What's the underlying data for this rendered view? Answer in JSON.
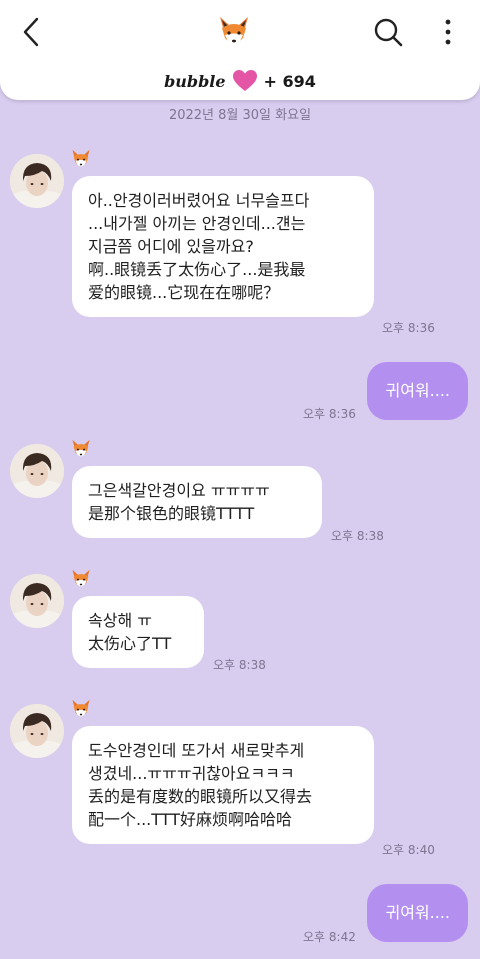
{
  "header": {
    "bubble_label": "bubble",
    "bubble_count": "+ 694"
  },
  "date_divider": "2022년 8월 30일 화요일",
  "messages": [
    {
      "lines": [
        "아..안경이러버렸어요 너무슬프다",
        "...내가젤 아끼는 안경인데...걘는",
        "지금쯤 어디에 있을까요?",
        "啊..眼镜丢了太伤心了...是我最",
        "爱的眼镜...它现在在哪呢？"
      ],
      "time": "오후 8:36"
    },
    {
      "text": "귀여워....",
      "time": "오후 8:36"
    },
    {
      "lines": [
        "그은색갈안경이요 ㅠㅠㅠㅠ",
        "是那个银色的眼镜TTTT"
      ],
      "time": "오후 8:38"
    },
    {
      "lines": [
        "속상해 ㅠ",
        "太伤心了TT"
      ],
      "time": "오후 8:38"
    },
    {
      "lines": [
        "도수안경인데 또가서 새로맞추게",
        "생겼네...ㅠㅠㅠ귀찮아요ㅋㅋㅋ",
        "丢的是有度数的眼镜所以又得去",
        "配一个...TTT好麻烦啊哈哈哈"
      ],
      "time": "오후 8:40"
    },
    {
      "text": "귀여워....",
      "time": "오후 8:42"
    }
  ],
  "colors": {
    "background": "#d8ccef",
    "sent_bubble": "#b38ff0",
    "received_bubble": "#ffffff",
    "heart": "#e455a6"
  },
  "icons": [
    "back-arrow-icon",
    "fox-icon",
    "search-icon",
    "more-vertical-icon",
    "heart-icon"
  ]
}
